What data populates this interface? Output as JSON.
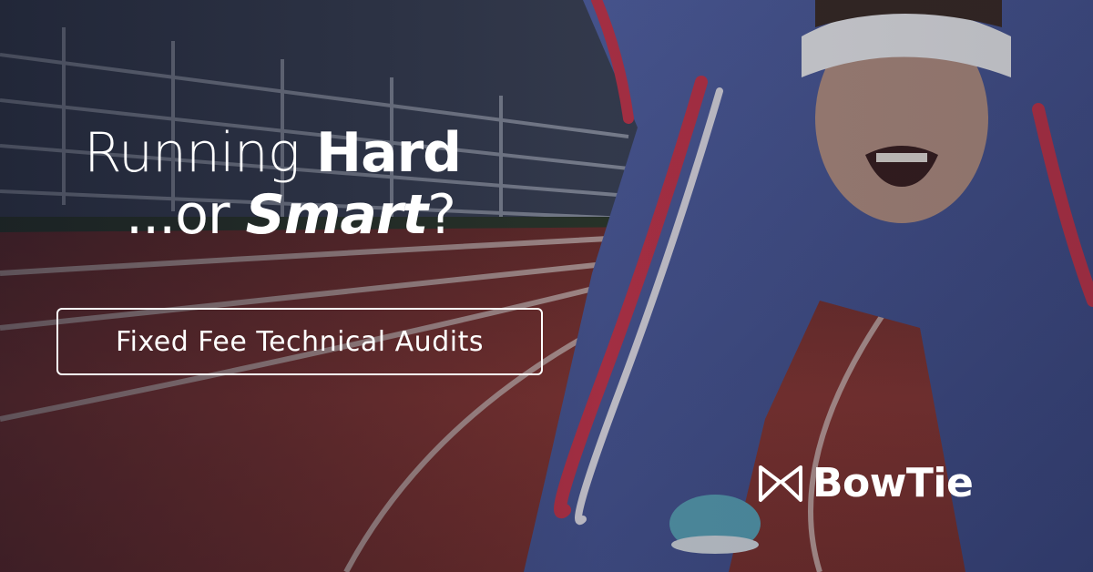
{
  "headline": {
    "line1_regular": "Running",
    "line1_bold": "Hard",
    "line2_regular": "...or",
    "line2_bold": "Smart",
    "line2_end": "?"
  },
  "cta": {
    "label": "Fixed Fee Technical Audits"
  },
  "brand": {
    "name": "BowTie",
    "icon": "bowtie-icon"
  },
  "colors": {
    "text": "#ffffff",
    "track": "#8f3a33",
    "suit": "#4a5a9c",
    "stripe": "#c23a4a"
  }
}
